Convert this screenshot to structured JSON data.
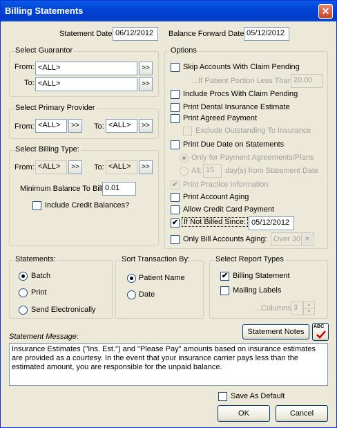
{
  "window": {
    "title": "Billing Statements",
    "close_glyph": "✕"
  },
  "dates": {
    "statement_date_label": "Statement Date:",
    "statement_date_value": "06/12/2012",
    "balance_forward_label": "Balance Forward Date:",
    "balance_forward_value": "05/12/2012"
  },
  "guarantor": {
    "legend": "Select Guarantor",
    "from_label": "From:",
    "from_value": "<ALL>",
    "to_label": "To:",
    "to_value": "<ALL>",
    "picker_label": ">>"
  },
  "provider": {
    "legend": "Select Primary Provider",
    "from_label": "From:",
    "from_value": "<ALL>",
    "to_label": "To:",
    "to_value": "<ALL>",
    "picker_label": ">>"
  },
  "billing_type": {
    "legend": "Select Billing Type:",
    "from_label": "From:",
    "from_value": "<ALL>",
    "to_label": "To:",
    "to_value": "<ALL>",
    "picker_label": ">>",
    "min_balance_label": "Minimum Balance To Bill:",
    "min_balance_value": "0.01",
    "include_credit_label": "Include Credit Balances?"
  },
  "options": {
    "legend": "Options",
    "skip_claim_pending": "Skip Accounts With Claim Pending",
    "patient_portion_label": "...If Patient Portion Less Than:",
    "patient_portion_value": "20.00",
    "include_procs": "Include Procs With Claim Pending",
    "print_dental_estimate": "Print Dental Insurance Estimate",
    "print_agreed_payment": "Print Agreed Payment",
    "exclude_outstanding": "Exclude Outstanding To Insurance",
    "print_due_date": "Print Due Date on Statements",
    "only_payment_agreements": "Only for Payment Agreements/Plans",
    "all_label": "All:",
    "all_days_value": "15",
    "days_suffix": "day(s) from Statement Date",
    "print_practice_info": "Print Practice Information",
    "print_account_aging": "Print Account Aging",
    "allow_credit_card": "Allow Credit Card Payment",
    "if_not_billed_since": "If Not Billed Since:",
    "not_billed_date": "05/12/2012",
    "only_bill_aging": "Only Bill Accounts Aging:",
    "aging_value": "Over 30",
    "check_mark": "✔"
  },
  "statements": {
    "legend": "Statements:",
    "batch": "Batch",
    "print": "Print",
    "send_electronically": "Send Electronically"
  },
  "sort": {
    "legend": "Sort Transaction By:",
    "patient_name": "Patient Name",
    "date": "Date"
  },
  "report_types": {
    "legend": "Select Report Types",
    "billing_statement": "Billing Statement",
    "mailing_labels": "Mailing Labels",
    "columns_label": "...Columns:",
    "columns_value": "3"
  },
  "message": {
    "label": "Statement Message:",
    "notes_button": "Statement Notes",
    "spell_icon_text": "ABC",
    "text": "Insurance Estimates (\"Ins. Est.\") and \"Please Pay\" amounts based on insurance estimates are provided as a courtesy.  In the event that your insurance carrier pays less than the estimated amount, you are responsible for the unpaid balance."
  },
  "footer": {
    "save_default": "Save As Default",
    "ok": "OK",
    "cancel": "Cancel"
  }
}
